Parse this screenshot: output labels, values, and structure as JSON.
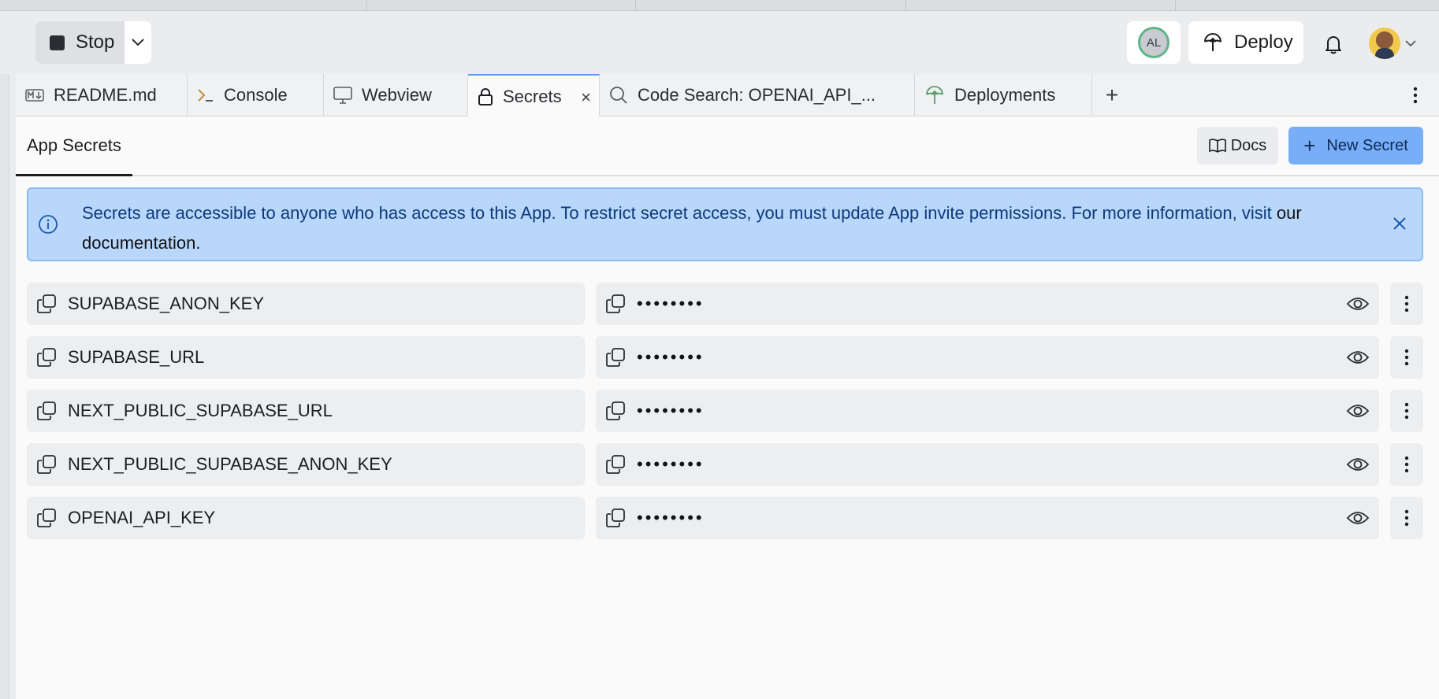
{
  "toolbar": {
    "stop_label": "Stop",
    "avatar_initials": "AL",
    "deploy_label": "Deploy"
  },
  "tabs": [
    {
      "label": "README.md",
      "icon": "markdown-icon"
    },
    {
      "label": "Console",
      "icon": "terminal-icon"
    },
    {
      "label": "Webview",
      "icon": "monitor-icon"
    },
    {
      "label": "Secrets",
      "icon": "lock-icon",
      "active": true
    },
    {
      "label": "Code Search: OPENAI_API_...",
      "icon": "search-icon"
    },
    {
      "label": "Deployments",
      "icon": "deploy-icon"
    }
  ],
  "pane": {
    "title": "App Secrets",
    "docs_label": "Docs",
    "new_secret_label": "New Secret"
  },
  "banner": {
    "text": "Secrets are accessible to anyone who has access to this App. To restrict secret access, you must update App invite permissions. For more information,",
    "link_text": "visit",
    "doc_text": "our documentation."
  },
  "secrets": [
    {
      "key": "SUPABASE_ANON_KEY",
      "masked_value": "••••••••"
    },
    {
      "key": "SUPABASE_URL",
      "masked_value": "••••••••"
    },
    {
      "key": "NEXT_PUBLIC_SUPABASE_URL",
      "masked_value": "••••••••"
    },
    {
      "key": "NEXT_PUBLIC_SUPABASE_ANON_KEY",
      "masked_value": "••••••••"
    },
    {
      "key": "OPENAI_API_KEY",
      "masked_value": "••••••••"
    }
  ],
  "colors": {
    "accent": "#77aef7",
    "banner_bg": "#b9d7fb",
    "active_tab_border": "#5b9cf5"
  }
}
